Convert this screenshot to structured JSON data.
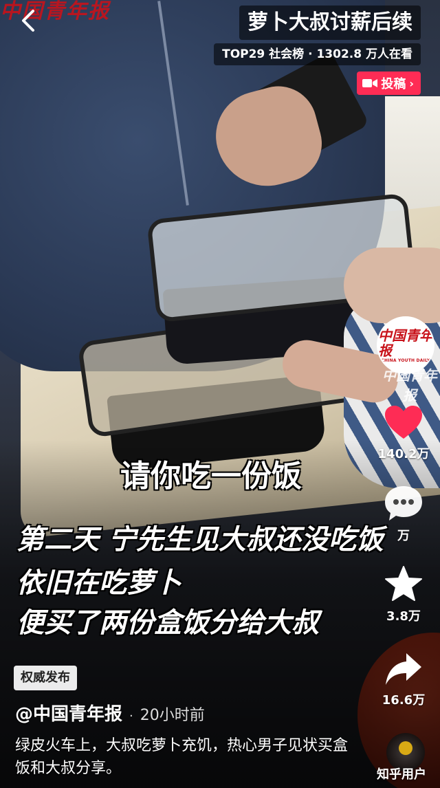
{
  "header": {
    "watermark": "中国青年报",
    "topic_title": "萝卜大叔讨薪后续",
    "rank_text": "TOP29 社会榜 · 1302.8 万人在看",
    "submit_label": "投稿"
  },
  "subtitles": {
    "line1": "请你吃一份饭",
    "line2": "第二天 宁先生见大叔还没吃饭",
    "line3": "依旧在吃萝卜",
    "line4": "便买了两份盒饭分给大叔"
  },
  "rail": {
    "avatar_logo": "中国青年报",
    "avatar_logo_en": "CHINA YOUTH DAILY",
    "avatar_tag": "中国青年报",
    "like_count": "140.2万",
    "comment_count": "万",
    "favorite_count": "3.8万",
    "share_count": "16.6万",
    "zhihu_user": "知乎用户"
  },
  "info": {
    "tag": "权威发布",
    "author": "@中国青年报",
    "separator": "·",
    "time": "20小时前",
    "description": "绿皮火车上，大叔吃萝卜充饥，热心男子见状买盒饭和大叔分享。"
  },
  "colors": {
    "accent": "#fe2c55",
    "like": "#fe2c55",
    "brand_red": "#c8121a"
  }
}
